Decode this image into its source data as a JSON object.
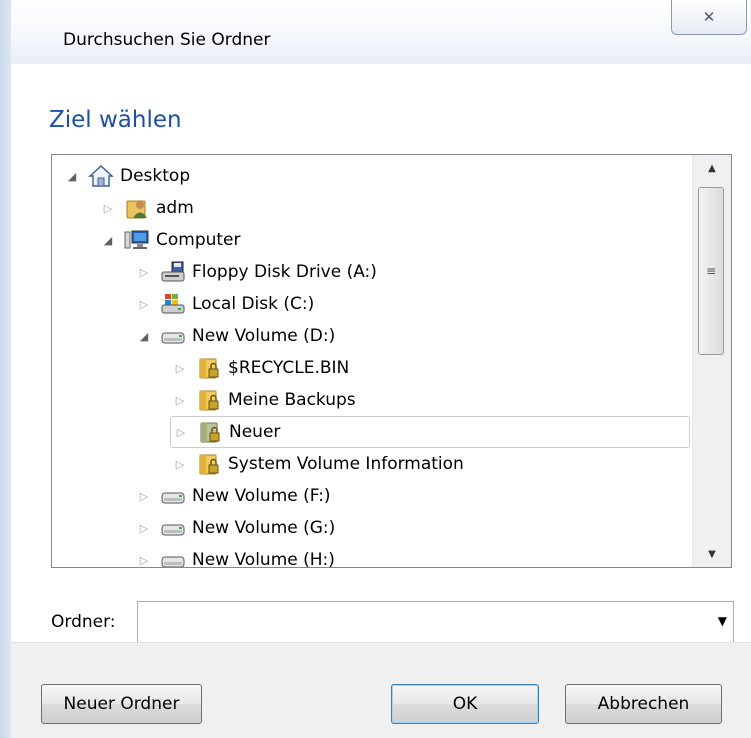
{
  "window": {
    "title": "Durchsuchen Sie Ordner",
    "close_glyph": "✕"
  },
  "heading": "Ziel wählen",
  "tree": {
    "items": [
      {
        "label": "Desktop",
        "icon": "home-icon",
        "expanded": true,
        "level": 0
      },
      {
        "label": "adm",
        "icon": "user-folder-icon",
        "expanded": false,
        "level": 1
      },
      {
        "label": "Computer",
        "icon": "computer-icon",
        "expanded": true,
        "level": 1
      },
      {
        "label": "Floppy Disk Drive (A:)",
        "icon": "floppy-drive-icon",
        "expanded": false,
        "level": 2
      },
      {
        "label": "Local Disk (C:)",
        "icon": "system-drive-icon",
        "expanded": false,
        "level": 2
      },
      {
        "label": "New Volume (D:)",
        "icon": "drive-icon",
        "expanded": true,
        "level": 2
      },
      {
        "label": "$RECYCLE.BIN",
        "icon": "locked-folder-icon",
        "expanded": false,
        "level": 3
      },
      {
        "label": "Meine Backups",
        "icon": "locked-folder-icon",
        "expanded": false,
        "level": 3
      },
      {
        "label": "Neuer",
        "icon": "locked-folder-icon",
        "expanded": false,
        "level": 3,
        "highlighted": true
      },
      {
        "label": "System Volume Information",
        "icon": "locked-folder-icon",
        "expanded": false,
        "level": 3
      },
      {
        "label": "New Volume (F:)",
        "icon": "drive-icon",
        "expanded": false,
        "level": 2
      },
      {
        "label": "New Volume (G:)",
        "icon": "drive-icon",
        "expanded": false,
        "level": 2
      },
      {
        "label": "New Volume (H:)",
        "icon": "drive-icon",
        "expanded": false,
        "level": 2,
        "partially_visible": true
      }
    ]
  },
  "folder_field": {
    "label": "Ordner:",
    "value": "",
    "placeholder": ""
  },
  "buttons": {
    "new_folder": "Neuer Ordner",
    "ok": "OK",
    "cancel": "Abbrechen"
  },
  "colors": {
    "heading": "#1e4fa1",
    "selection_outline": "#c8cdd4"
  }
}
